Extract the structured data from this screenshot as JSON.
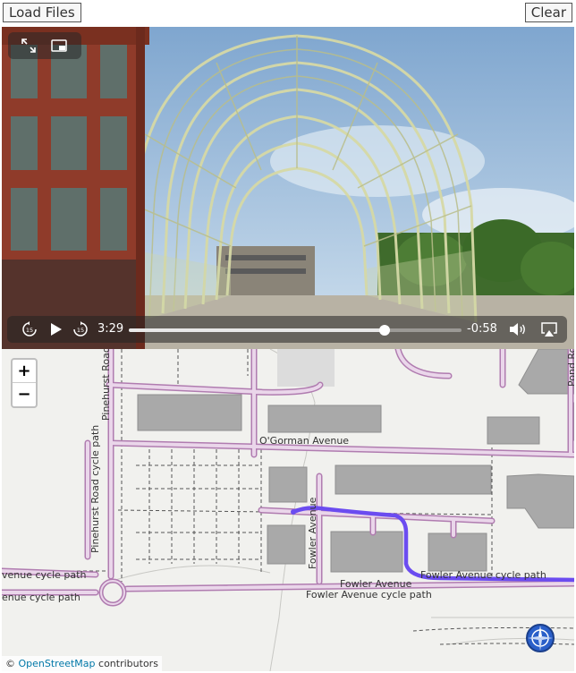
{
  "toolbar": {
    "load_label": "Load Files",
    "clear_label": "Clear"
  },
  "video": {
    "current_time": "3:29",
    "remaining_time": "-0:58",
    "progress_fraction": 0.77
  },
  "map": {
    "zoom_in": "+",
    "zoom_out": "−",
    "streets": {
      "ogorman": "O'Gorman Avenue",
      "fowler": "Fowler Avenue",
      "fowler_v": "Fowler Avenue",
      "fowler_cycle_1": "Fowler Avenue cycle path",
      "fowler_cycle_2": "Fowler Avenue cycle path",
      "pinehurst_road": "Pinehurst Road",
      "pinehurst_cycle": "Pinehurst Road cycle path",
      "avenue_cycle_1": "venue cycle path",
      "avenue_cycle_2": "enue cycle path",
      "pond_road": "Pond Ro"
    },
    "attribution_prefix": "©",
    "attribution_link": "OpenStreetMap",
    "attribution_suffix": "contributors",
    "route_color": "#6b4cf0",
    "road_color": "#d8a7d6"
  }
}
